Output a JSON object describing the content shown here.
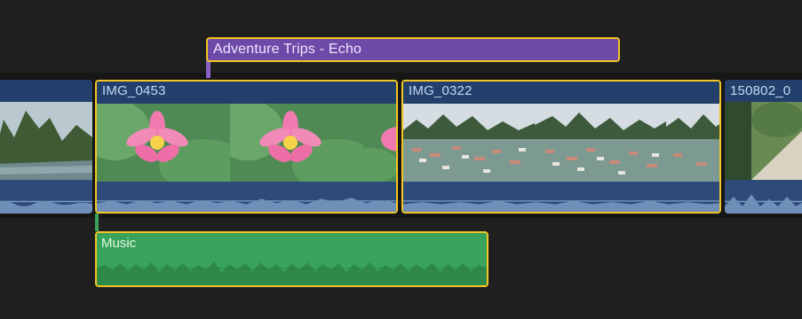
{
  "timeline": {
    "title_clip": {
      "label": "Adventure Trips - Echo",
      "color": "#6e4aa8"
    },
    "video_clips": [
      {
        "label": "",
        "selected": false
      },
      {
        "label": "IMG_0453",
        "selected": true
      },
      {
        "label": "IMG_0322",
        "selected": true
      },
      {
        "label": "150802_0",
        "selected": false
      }
    ],
    "music_clip": {
      "label": "Music",
      "color": "#3aa35b"
    },
    "selection_color": "#f2c524"
  }
}
